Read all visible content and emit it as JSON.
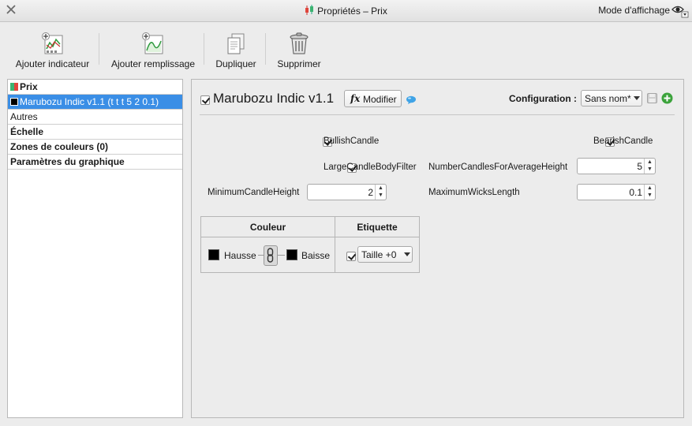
{
  "window": {
    "title": "Propriétés – Prix",
    "view_mode": "Mode d'affichage"
  },
  "toolbar": {
    "add_indicator": "Ajouter indicateur",
    "add_fill": "Ajouter remplissage",
    "duplicate": "Dupliquer",
    "delete": "Supprimer"
  },
  "nav": {
    "items": [
      {
        "label": "Prix"
      },
      {
        "label": "Marubozu Indic v1.1 (t t t 5 2 0.1)"
      },
      {
        "label": "Autres"
      },
      {
        "label": "Échelle"
      },
      {
        "label": "Zones de couleurs (0)"
      },
      {
        "label": "Paramètres du graphique"
      }
    ]
  },
  "panel": {
    "indicator_name": "Marubozu Indic v1.1",
    "modify_label": "Modifier",
    "fx_glyph": "fx",
    "configuration_label": "Configuration :",
    "configuration_value": "Sans nom*",
    "params": {
      "bullish": "BullishCandle",
      "bearish": "BearishCandle",
      "large_body": "LargeCandleBodyFilter",
      "num_candles_label": "NumberCandlesForAverageHeight",
      "num_candles_value": "5",
      "min_height_label": "MinimumCandleHeight",
      "min_height_value": "2",
      "max_wicks_label": "MaximumWicksLength",
      "max_wicks_value": "0.1"
    },
    "table": {
      "col_color": "Couleur",
      "col_label": "Etiquette",
      "up_label": "Hausse",
      "down_label": "Baisse",
      "size_value": "Taille +0"
    }
  },
  "colors": {
    "selection": "#3a8ee6",
    "prix_green": "#3cb371",
    "prix_red": "#e0463c",
    "candle_color": "#000000"
  }
}
